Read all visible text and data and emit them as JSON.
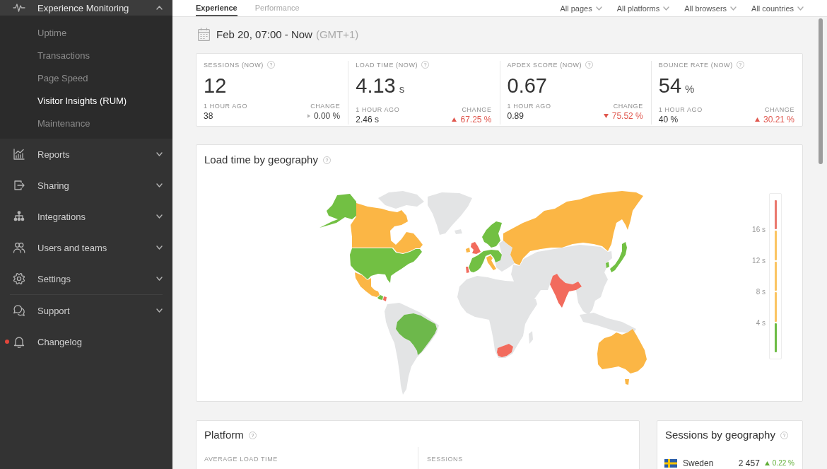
{
  "sidebar": {
    "sections": [
      {
        "items": [
          {
            "kind": "group",
            "label": "Experience Monitoring",
            "expanded": true,
            "unread": false,
            "children": [
              {
                "label": "Uptime",
                "selected": false
              },
              {
                "label": "Transactions",
                "selected": false
              },
              {
                "label": "Page Speed",
                "selected": false
              },
              {
                "label": "Visitor Insights (RUM)",
                "selected": true
              },
              {
                "label": "Maintenance",
                "selected": false
              }
            ]
          },
          {
            "kind": "group",
            "label": "Reports",
            "expanded": false,
            "unread": false
          },
          {
            "kind": "group",
            "label": "Sharing",
            "expanded": false,
            "unread": false
          },
          {
            "kind": "group",
            "label": "Integrations",
            "expanded": false,
            "unread": false
          },
          {
            "kind": "group",
            "label": "Users and teams",
            "expanded": false,
            "unread": false
          },
          {
            "kind": "group",
            "label": "Settings",
            "expanded": false,
            "unread": false
          }
        ]
      },
      {
        "items": [
          {
            "kind": "group",
            "label": "Support",
            "expanded": false,
            "unread": false
          },
          {
            "kind": "link",
            "label": "Changelog",
            "unread": true
          }
        ]
      }
    ]
  },
  "tabs": [
    {
      "label": "Experience",
      "selected": true
    },
    {
      "label": "Performance",
      "selected": false
    }
  ],
  "filters": [
    "All pages",
    "All platforms",
    "All browsers",
    "All countries"
  ],
  "date_range": {
    "range": "Feb 20, 07:00 - Now",
    "timezone": "(GMT+1)"
  },
  "metrics": [
    {
      "label": "SESSIONS (NOW)",
      "help": "?",
      "value": "12",
      "previous_label": "1 HOUR AGO",
      "previous": "38",
      "change_label": "CHANGE",
      "change": {
        "text": "0.00 %",
        "kind": "flat",
        "color": "#b0b0b0"
      }
    },
    {
      "label": "LOAD TIME (NOW)",
      "help": "?",
      "value": "4.13",
      "unit": "s",
      "previous_label": "1 HOUR AGO",
      "previous": "2.46 s",
      "change_label": "CHANGE",
      "change": {
        "text": "67.25 %",
        "kind": "up",
        "color": "#e0564d"
      }
    },
    {
      "label": "APDEX SCORE (NOW)",
      "help": "?",
      "value": "0.67",
      "previous_label": "1 HOUR AGO",
      "previous": "0.89",
      "change_label": "CHANGE",
      "change": {
        "text": "75.52 %",
        "kind": "down",
        "color": "#e0564d"
      }
    },
    {
      "label": "BOUNCE RATE (NOW)",
      "help": "?",
      "value": "54",
      "unit": "%",
      "previous_label": "1 HOUR AGO",
      "previous": "40 %",
      "change_label": "CHANGE",
      "change": {
        "text": "30.21 %",
        "kind": "up",
        "color": "#e0564d"
      }
    }
  ],
  "load_map": {
    "title": "Load time by geography",
    "help": "?",
    "countries": [
      {
        "color": "#72c043"
      },
      {
        "color": "#fbb645"
      },
      {
        "color": "#72c043"
      },
      {
        "color": "#fbb645"
      },
      {
        "color": "#72c043"
      },
      {
        "color": "#f26b5d"
      },
      {
        "color": "#6db84b"
      },
      {
        "color": "#72c043"
      },
      {
        "color": "#72c043"
      },
      {
        "color": "#f26b5d"
      },
      {
        "color": "#fbb645"
      },
      {
        "color": "#f26b5d"
      },
      {
        "color": "#fbb645"
      },
      {
        "color": "#fbb645"
      },
      {
        "color": "#f26b5d"
      },
      {
        "color": "#72c043"
      },
      {
        "color": "#72c043"
      },
      {
        "color": "#f26b5d"
      },
      {
        "color": "#fbb645"
      }
    ],
    "legend": {
      "labels": [
        "16 s",
        "12 s",
        "8 s",
        "4 s"
      ],
      "segments": [
        {
          "color": "#ea786d"
        },
        {
          "color": "#fbc462"
        },
        {
          "color": "#fbc462"
        },
        {
          "color": "#fbc462"
        },
        {
          "color": "#6cbc45"
        }
      ]
    }
  },
  "platform": {
    "title": "Platform",
    "help": "?",
    "columns": [
      "AVERAGE LOAD TIME",
      "SESSIONS"
    ]
  },
  "sessions_by_geography": {
    "title": "Sessions by geography",
    "help": "?",
    "rows": [
      {
        "country": "Sweden",
        "sessions": "2 457",
        "change": {
          "text": "0.22 %",
          "kind": "up",
          "color": "#5fae35"
        }
      }
    ]
  }
}
